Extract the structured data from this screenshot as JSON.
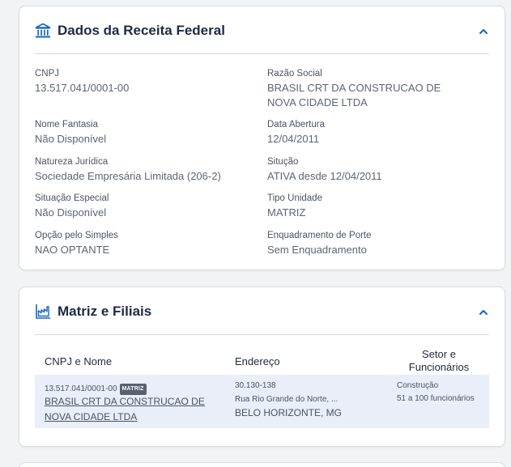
{
  "receita": {
    "title": "Dados da Receita Federal",
    "fields": [
      {
        "label": "CNPJ",
        "value": "13.517.041/0001-00"
      },
      {
        "label": "Razão Social",
        "value": "BRASIL CRT DA CONSTRUCAO DE NOVA CIDADE LTDA"
      },
      {
        "label": "Nome Fantasia",
        "value": "Não Disponível"
      },
      {
        "label": "Data Abertura",
        "value": "12/04/2011"
      },
      {
        "label": "Natureza Jurídica",
        "value": "Sociedade Empresária Limitada (206-2)"
      },
      {
        "label": "Situção",
        "value": "ATIVA desde 12/04/2011"
      },
      {
        "label": "Situação Especial",
        "value": "Não Disponível"
      },
      {
        "label": "Tipo Unidade",
        "value": "MATRIZ"
      },
      {
        "label": "Opção pelo Simples",
        "value": "NAO OPTANTE"
      },
      {
        "label": "Enquadramento de Porte",
        "value": "Sem Enquadramento"
      }
    ]
  },
  "matriz": {
    "title": "Matriz e Filiais",
    "columns": {
      "cnpj_nome": "CNPJ e Nome",
      "endereco": "Endereço",
      "setor": "Setor e Funcionários"
    },
    "rows": [
      {
        "cnpj": "13.517.041/0001-00",
        "badge": "MATRIZ",
        "nome": "BRASIL CRT DA CONSTRUCAO DE NOVA CIDADE LTDA",
        "cep": "30.130-138",
        "rua": "Rua Rio Grande do Norte, ...",
        "cidade": "BELO HORIZONTE, MG",
        "setor": "Construção",
        "funcionarios": "51 a 100 funcionários"
      }
    ]
  },
  "colors": {
    "accent": "#1565c0",
    "title": "#1c2b45",
    "row_highlight": "#e9eef8"
  }
}
